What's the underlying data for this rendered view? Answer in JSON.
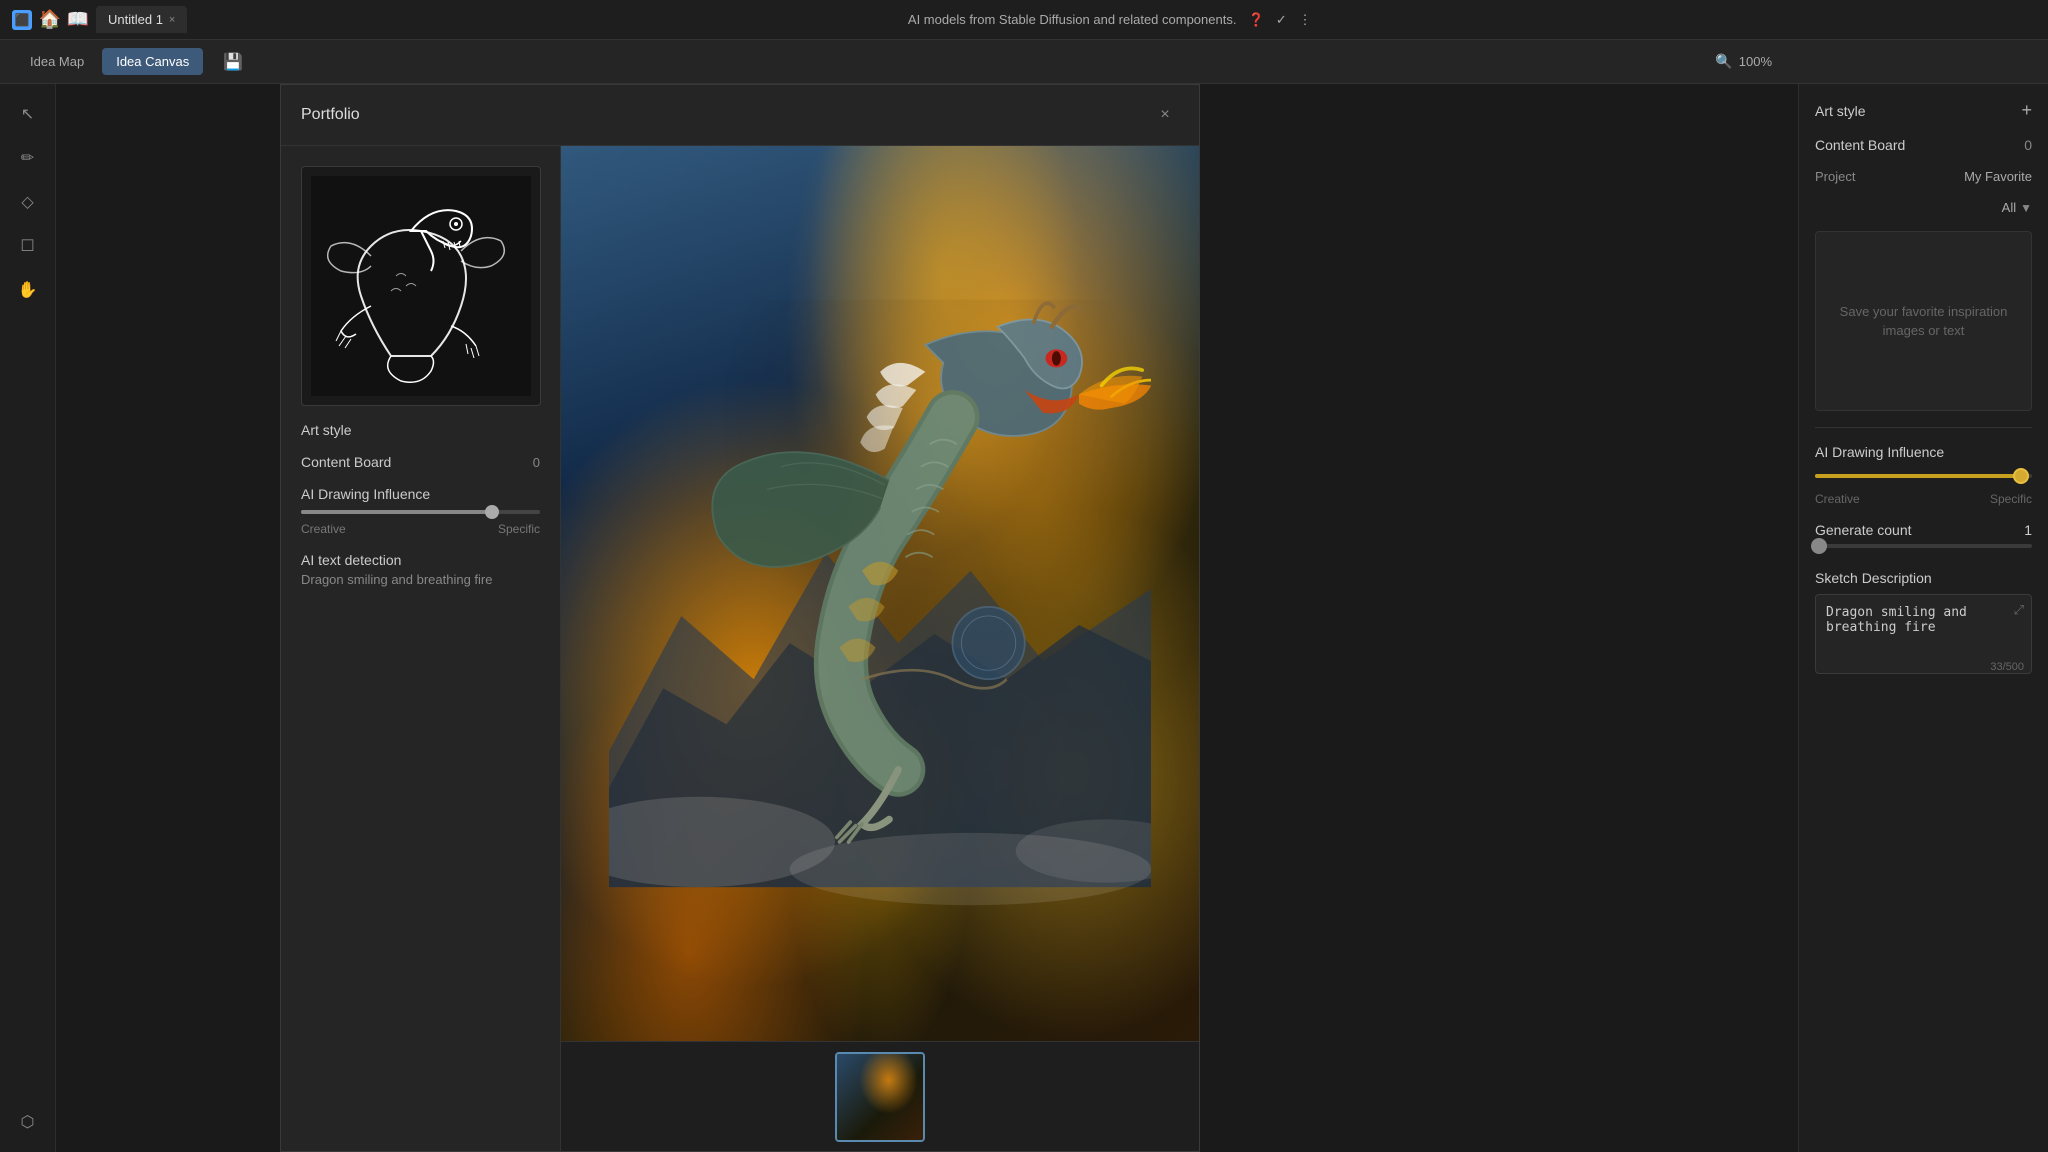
{
  "titlebar": {
    "window_icon": "⬛",
    "tab_title": "Untitled 1",
    "tab_close": "×",
    "center_text": "AI models from Stable Diffusion and related components.",
    "zoom_percent": "100%"
  },
  "toolbar": {
    "tab_idea_map": "Idea Map",
    "tab_idea_canvas": "Idea Canvas",
    "save_icon": "💾"
  },
  "sidebar": {
    "tools": [
      "↖",
      "✏",
      "◇",
      "☐",
      "✋",
      "⬡"
    ]
  },
  "portfolio_modal": {
    "title": "Portfolio",
    "close": "×",
    "art_style_label": "Art style",
    "content_board_label": "Content Board",
    "content_board_value": "0",
    "ai_drawing_influence_label": "AI Drawing Influence",
    "creative_label": "Creative",
    "specific_label": "Specific",
    "ai_text_detection_label": "AI text detection",
    "ai_text_detection_value": "Dragon smiling and breathing fire",
    "slider_position_pct": "80"
  },
  "right_panel": {
    "art_style_label": "Art style",
    "art_style_add": "+",
    "content_board_label": "Content Board",
    "content_board_value": "0",
    "project_label": "Project",
    "project_value": "My Favorite",
    "dropdown_value": "All",
    "content_board_placeholder": "Save your favorite inspiration images or text",
    "ai_drawing_influence_label": "AI Drawing Influence",
    "creative_label": "Creative",
    "specific_label": "Specific",
    "generate_count_label": "Generate count",
    "generate_count_value": "1",
    "sketch_description_label": "Sketch Description",
    "sketch_description_value": "Dragon smiling and breathing fire",
    "char_count": "33/500"
  }
}
